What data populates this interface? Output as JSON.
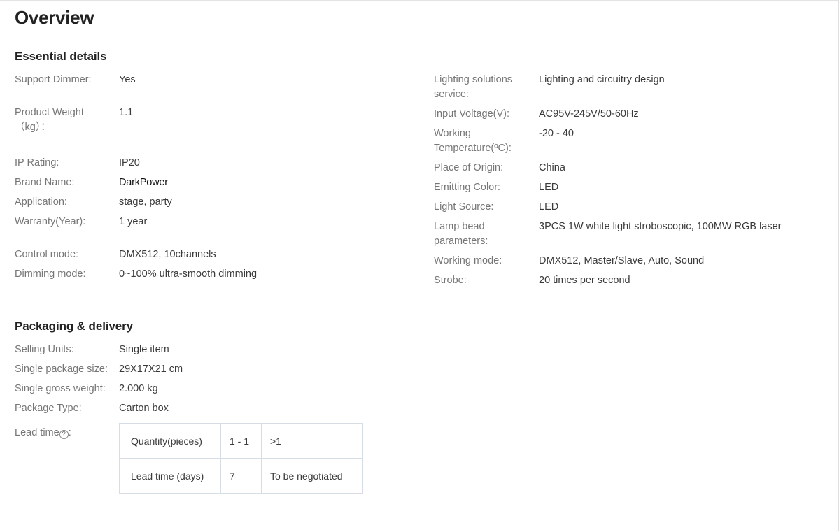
{
  "page": {
    "title": "Overview"
  },
  "essential": {
    "heading": "Essential details",
    "left": [
      {
        "label": "Support Dimmer:",
        "value": "Yes"
      },
      {
        "label": "Product Weight（kg）：",
        "value": "1.1"
      },
      {
        "label": "IP Rating:",
        "value": "IP20"
      },
      {
        "label": "Brand Name:",
        "value": "DarkPower"
      },
      {
        "label": "Application:",
        "value": "stage, party"
      },
      {
        "label": "Warranty(Year):",
        "value": "1 year"
      },
      {
        "label": "Control mode:",
        "value": "DMX512, 10channels"
      },
      {
        "label": "Dimming mode:",
        "value": "0~100% ultra-smooth dimming"
      }
    ],
    "right": [
      {
        "label": "Lighting solutions service:",
        "value": "Lighting and circuitry design"
      },
      {
        "label": "Input Voltage(V):",
        "value": "AC95V-245V/50-60Hz"
      },
      {
        "label": "Working Temperature(ºC):",
        "value": "-20 - 40"
      },
      {
        "label": "Place of Origin:",
        "value": "China"
      },
      {
        "label": "Emitting Color:",
        "value": "LED"
      },
      {
        "label": "Light Source:",
        "value": "LED"
      },
      {
        "label": "Lamp bead parameters:",
        "value": "3PCS 1W white light stroboscopic, 100MW RGB laser"
      },
      {
        "label": "Working mode:",
        "value": "DMX512, Master/Slave, Auto, Sound"
      },
      {
        "label": "Strobe:",
        "value": "20 times per second"
      }
    ]
  },
  "packaging": {
    "heading": "Packaging & delivery",
    "rows": [
      {
        "label": "Selling Units:",
        "value": "Single item"
      },
      {
        "label": "Single package size:",
        "value": "29X17X21 cm"
      },
      {
        "label": "Single gross weight:",
        "value": "2.000 kg"
      },
      {
        "label": "Package Type:",
        "value": "Carton box"
      }
    ],
    "lead_time": {
      "label_prefix": "Lead time",
      "label_suffix": ":",
      "help_icon": "question-mark-icon",
      "help_glyph": "?",
      "table": [
        [
          "Quantity(pieces)",
          "1 - 1",
          ">1"
        ],
        [
          "Lead time (days)",
          "7",
          "To be negotiated"
        ]
      ]
    }
  },
  "colors": {
    "label": "#767676",
    "value": "#3a3a3a",
    "heading": "#222222",
    "divider": "#e2e2e2",
    "table_border": "#d6dde4"
  }
}
